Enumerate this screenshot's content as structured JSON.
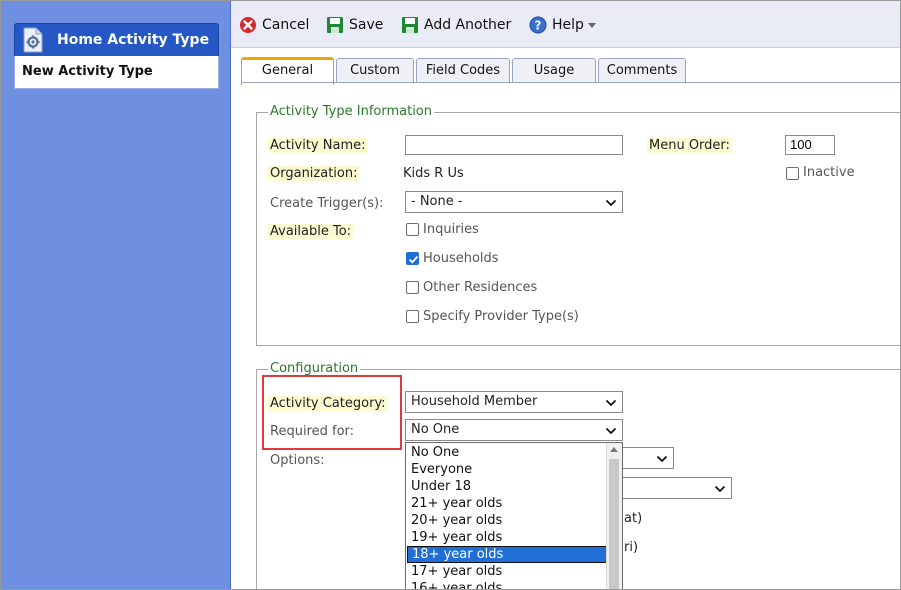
{
  "sidebar": {
    "header": {
      "title": "Home Activity Type",
      "icon": "gear-document-icon"
    },
    "items": [
      {
        "label": "New Activity Type"
      }
    ]
  },
  "toolbar": {
    "cancel_label": "Cancel",
    "save_label": "Save",
    "add_another_label": "Add Another",
    "help_label": "Help"
  },
  "tabs": [
    {
      "label": "General",
      "active": true
    },
    {
      "label": "Custom"
    },
    {
      "label": "Field Codes"
    },
    {
      "label": "Usage"
    },
    {
      "label": "Comments"
    }
  ],
  "activity_info": {
    "legend": "Activity Type Information",
    "activity_name_label": "Activity Name:",
    "activity_name_value": "",
    "menu_order_label": "Menu Order:",
    "menu_order_value": "100",
    "inactive_label": "Inactive",
    "organization_label": "Organization:",
    "organization_value": "Kids R Us",
    "create_trigger_label": "Create Trigger(s):",
    "create_trigger_value": "- None -",
    "available_to_label": "Available To:",
    "available_to": [
      {
        "label": "Inquiries",
        "checked": false
      },
      {
        "label": "Households",
        "checked": true
      },
      {
        "label": "Other Residences",
        "checked": false
      },
      {
        "label": "Specify Provider Type(s)",
        "checked": false
      }
    ]
  },
  "configuration": {
    "legend": "Configuration",
    "activity_category_label": "Activity Category:",
    "activity_category_value": "Household Member",
    "required_for_label": "Required for:",
    "required_for_value": "No One",
    "options_label": "Options:",
    "partial_text_1": "at)",
    "partial_text_2": "ri)",
    "dropdown_options": [
      "No One",
      "Everyone",
      "Under 18",
      "21+ year olds",
      "20+ year olds",
      "19+ year olds",
      "18+ year olds",
      "17+ year olds",
      "16+ year olds"
    ],
    "dropdown_highlighted": "18+ year olds"
  },
  "colors": {
    "sidebar_bg": "#6f8fe0",
    "sidebar_header": "#2558c4",
    "legend_text": "#2a7a2a",
    "required_highlight": "#fbfad0",
    "active_tab_accent": "#f0a500",
    "callout_border": "#e03a3a",
    "selection": "#1f6fd6"
  }
}
